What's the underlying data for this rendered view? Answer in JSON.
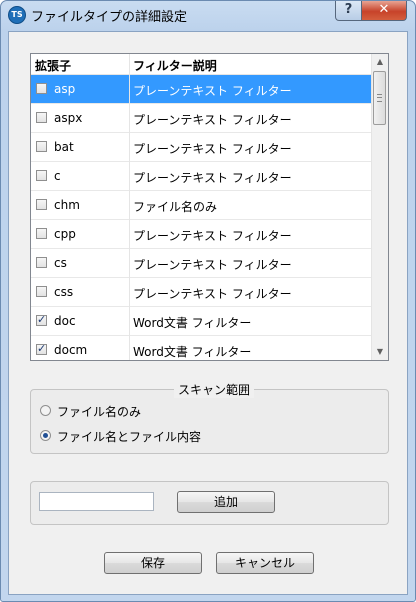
{
  "window": {
    "title": "ファイルタイプの詳細設定",
    "app_icon_text": "TS",
    "help_label": "?",
    "close_label": "✕"
  },
  "list": {
    "headers": {
      "extension": "拡張子",
      "filter_desc": "フィルター説明"
    },
    "rows": [
      {
        "ext": "asp",
        "filter": "プレーンテキスト フィルター",
        "checked": false,
        "selected": true
      },
      {
        "ext": "aspx",
        "filter": "プレーンテキスト フィルター",
        "checked": false,
        "selected": false
      },
      {
        "ext": "bat",
        "filter": "プレーンテキスト フィルター",
        "checked": false,
        "selected": false
      },
      {
        "ext": "c",
        "filter": "プレーンテキスト フィルター",
        "checked": false,
        "selected": false
      },
      {
        "ext": "chm",
        "filter": "ファイル名のみ",
        "checked": false,
        "selected": false
      },
      {
        "ext": "cpp",
        "filter": "プレーンテキスト フィルター",
        "checked": false,
        "selected": false
      },
      {
        "ext": "cs",
        "filter": "プレーンテキスト フィルター",
        "checked": false,
        "selected": false
      },
      {
        "ext": "css",
        "filter": "プレーンテキスト フィルター",
        "checked": false,
        "selected": false
      },
      {
        "ext": "doc",
        "filter": "Word文書 フィルター",
        "checked": true,
        "selected": false
      },
      {
        "ext": "docm",
        "filter": "Word文書 フィルター",
        "checked": true,
        "selected": false
      }
    ]
  },
  "scan_range": {
    "title": "スキャン範囲",
    "options": [
      {
        "label": "ファイル名のみ",
        "selected": false
      },
      {
        "label": "ファイル名とファイル内容",
        "selected": true
      }
    ]
  },
  "add": {
    "input_value": "",
    "button_label": "追加"
  },
  "footer": {
    "save_label": "保存",
    "cancel_label": "キャンセル"
  }
}
